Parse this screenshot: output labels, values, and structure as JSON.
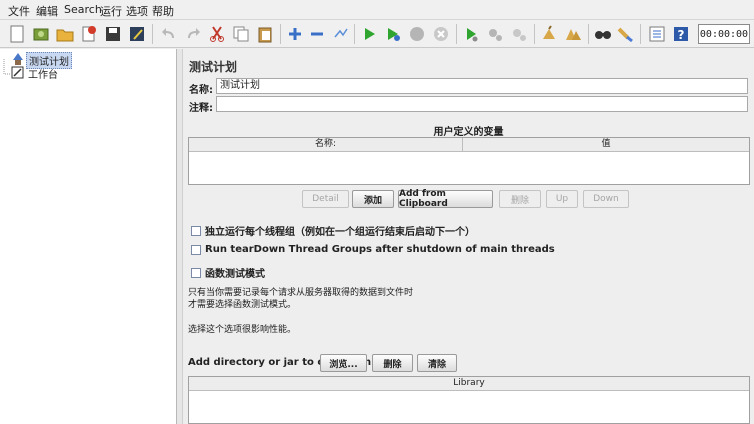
{
  "menu": {
    "items": [
      "文件",
      "编辑",
      "Search",
      "运行",
      "选项",
      "帮助"
    ]
  },
  "toolbar": {
    "timer": "00:00:00",
    "icons": [
      "new-icon",
      "templates-icon",
      "open-icon",
      "close-icon",
      "save-icon",
      "save-as-icon",
      "undo-icon",
      "redo-icon",
      "cut-icon",
      "copy-icon",
      "paste-icon",
      "expand-icon",
      "collapse-icon",
      "toggle-icon",
      "start-icon",
      "start-no-pause-icon",
      "stop-icon",
      "shutdown-icon",
      "remote-start-icon",
      "remote-stop-icon",
      "remote-shutdown-icon",
      "clear-icon",
      "clear-all-icon",
      "search-icon",
      "reset-search-icon",
      "function-helper-icon",
      "help-icon"
    ]
  },
  "tree": {
    "items": [
      {
        "label": "测试计划",
        "icon": "test-plan-icon",
        "selected": true
      },
      {
        "label": "工作台",
        "icon": "workbench-icon",
        "selected": false
      }
    ]
  },
  "panel": {
    "title": "测试计划",
    "name_label": "名称:",
    "name_value": "测试计划",
    "comment_label": "注释:",
    "comment_value": "",
    "variables_title": "用户定义的变量",
    "columns": [
      "名称:",
      "值"
    ],
    "buttons": {
      "detail": "Detail",
      "add": "添加",
      "add_clipboard": "Add from Clipboard",
      "delete": "删除",
      "up": "Up",
      "down": "Down"
    },
    "options": {
      "serialize": "独立运行每个线程组（例如在一个组运行结束后启动下一个）",
      "teardown": "Run tearDown Thread Groups after shutdown of main threads",
      "functional": "函数测试模式"
    },
    "note_line1": "只有当你需要记录每个请求从服务器取得的数据到文件时",
    "note_line2": "才需要选择函数测试模式。",
    "note_line3": "选择这个选项很影响性能。",
    "classpath_label": "Add directory or jar to classpath",
    "browse": "浏览...",
    "cp_delete": "删除",
    "cp_clear": "清除",
    "library_header": "Library"
  }
}
